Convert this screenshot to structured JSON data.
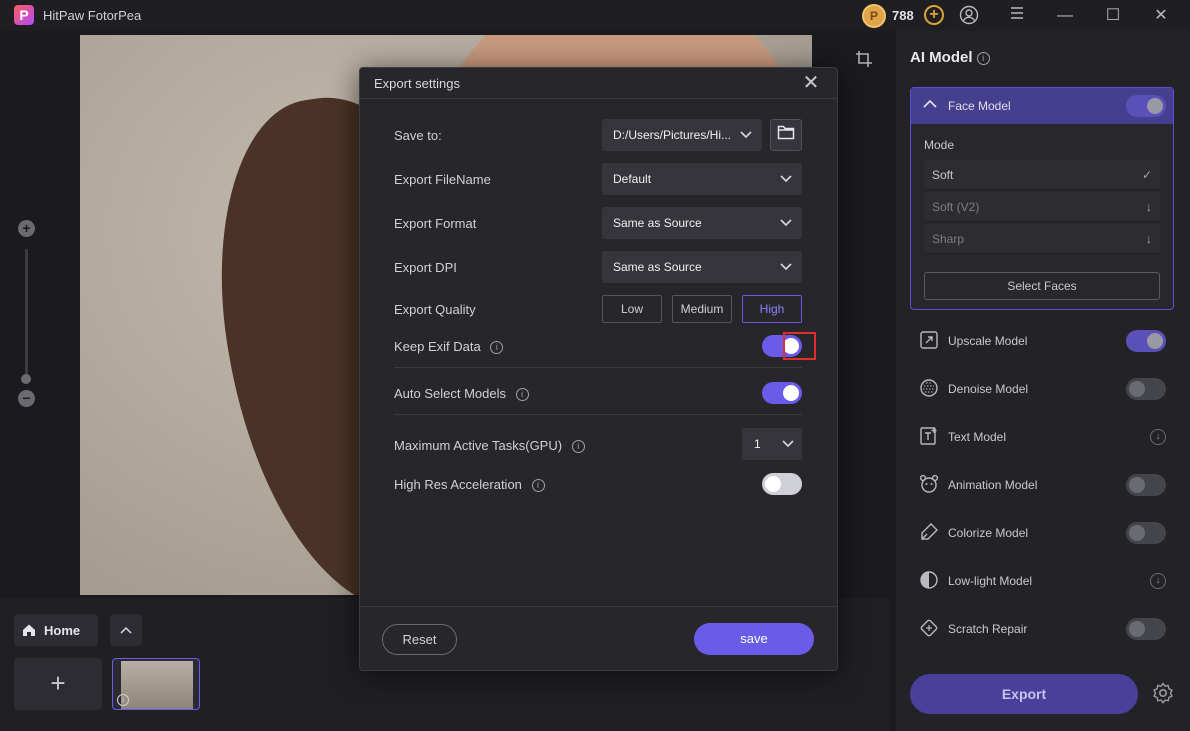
{
  "app": {
    "title": "HitPaw FotorPea",
    "logo_letter": "P"
  },
  "titlebar": {
    "coins": "788",
    "add_symbol": "+",
    "account_icon": "account-icon",
    "menu_icon": "menu-icon",
    "minimize": "—",
    "maximize": "☐",
    "close": "✕"
  },
  "canvas": {
    "zoom_in": "+",
    "zoom_out": "−",
    "zoom_level": 0.07
  },
  "bottom": {
    "home_label": "Home",
    "up_symbol": "⌃",
    "add_symbol": "+",
    "thumb_info": "i"
  },
  "panel": {
    "title": "AI Model",
    "face_model": {
      "label": "Face Model",
      "enabled": true,
      "mode_label": "Mode",
      "modes": [
        {
          "label": "Soft",
          "state": "✓"
        },
        {
          "label": "Soft (V2)",
          "state": "↓"
        },
        {
          "label": "Sharp",
          "state": "↓"
        }
      ],
      "select_faces": "Select Faces"
    },
    "models": [
      {
        "label": "Upscale Model",
        "icon": "upscale-icon",
        "control": "toggle-on"
      },
      {
        "label": "Denoise Model",
        "icon": "denoise-icon",
        "control": "toggle-off"
      },
      {
        "label": "Text Model",
        "icon": "text-model-icon",
        "control": "download"
      },
      {
        "label": "Animation Model",
        "icon": "animation-icon",
        "control": "toggle-off"
      },
      {
        "label": "Colorize Model",
        "icon": "colorize-icon",
        "control": "toggle-off"
      },
      {
        "label": "Low-light Model",
        "icon": "low-light-icon",
        "control": "download"
      },
      {
        "label": "Scratch Repair",
        "icon": "scratch-repair-icon",
        "control": "toggle-off"
      }
    ],
    "export_label": "Export"
  },
  "dialog": {
    "title": "Export settings",
    "close": "✕",
    "save_to": {
      "label": "Save to:",
      "value": "D:/Users/Pictures/Hi..."
    },
    "filename": {
      "label": "Export FileName",
      "value": "Default"
    },
    "format": {
      "label": "Export Format",
      "value": "Same as Source"
    },
    "dpi": {
      "label": "Export DPI",
      "value": "Same as Source"
    },
    "quality": {
      "label": "Export Quality",
      "options": [
        "Low",
        "Medium",
        "High"
      ],
      "selected": "High"
    },
    "keep_exif": {
      "label": "Keep Exif Data",
      "enabled": true
    },
    "auto_select": {
      "label": "Auto Select Models",
      "enabled": true
    },
    "max_tasks": {
      "label": "Maximum Active Tasks(GPU)",
      "value": "1"
    },
    "high_res": {
      "label": "High Res Acceleration",
      "enabled": false
    },
    "reset_label": "Reset",
    "save_label": "save"
  },
  "colors": {
    "accent": "#6a5ce8",
    "highlight": "#e0302e",
    "background": "#1b1b1f"
  }
}
